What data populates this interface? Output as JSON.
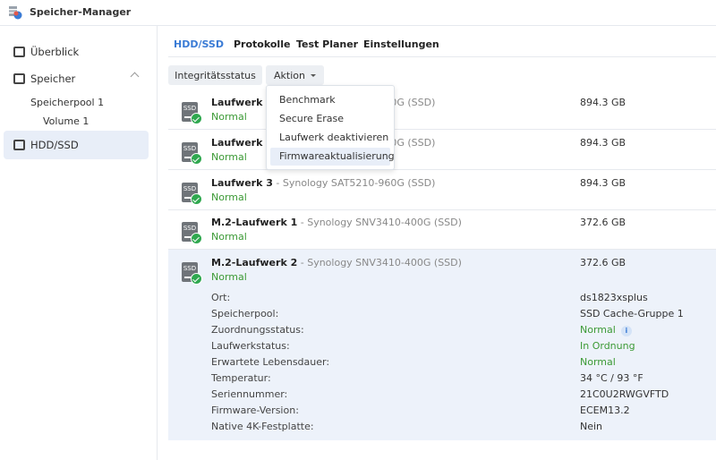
{
  "app": {
    "title": "Speicher-Manager"
  },
  "sidebar": {
    "items": [
      {
        "label": "Überblick",
        "icon": "overview-icon"
      },
      {
        "label": "Speicher",
        "icon": "storage-icon"
      },
      {
        "label": "Speicherpool 1"
      },
      {
        "label": "Volume 1"
      },
      {
        "label": "HDD/SSD",
        "icon": "drive-icon",
        "active": true
      }
    ]
  },
  "tabs": [
    {
      "label": "HDD/SSD",
      "active": true
    },
    {
      "label": "Protokolle"
    },
    {
      "label": "Test Planer"
    },
    {
      "label": "Einstellungen"
    }
  ],
  "toolbar": {
    "health_label": "Integritätsstatus",
    "action_label": "Aktion"
  },
  "menu": {
    "items": [
      "Benchmark",
      "Secure Erase",
      "Laufwerk deaktivieren",
      "Firmwareaktualisierung"
    ],
    "highlighted": "Firmwareaktualisierung"
  },
  "drives": [
    {
      "name": "Laufwerk 1",
      "model": " - Synology SAT5210-960G (SSD)",
      "status": "Normal",
      "size": "894.3 GB"
    },
    {
      "name": "Laufwerk 2",
      "model": " - Synology SAT5210-960G (SSD)",
      "status": "Normal",
      "size": "894.3 GB"
    },
    {
      "name": "Laufwerk 3",
      "model": " - Synology SAT5210-960G (SSD)",
      "status": "Normal",
      "size": "894.3 GB"
    },
    {
      "name": "M.2-Laufwerk 1",
      "model": " - Synology SNV3410-400G (SSD)",
      "status": "Normal",
      "size": "372.6 GB"
    },
    {
      "name": "M.2-Laufwerk 2",
      "model": " - Synology SNV3410-400G (SSD)",
      "status": "Normal",
      "size": "372.6 GB"
    }
  ],
  "details": [
    {
      "label": "Ort:",
      "value": "ds1823xsplus"
    },
    {
      "label": "Speicherpool:",
      "value": "SSD Cache-Gruppe 1"
    },
    {
      "label": "Zuordnungsstatus:",
      "value": "Normal",
      "green": true,
      "info": "i"
    },
    {
      "label": "Laufwerkstatus:",
      "value": "In Ordnung",
      "green": true
    },
    {
      "label": "Erwartete Lebensdauer:",
      "value": "Normal",
      "green": true
    },
    {
      "label": "Temperatur:",
      "value": "34 °C / 93 °F"
    },
    {
      "label": "Seriennummer:",
      "value": "21C0U2RWGVFTD"
    },
    {
      "label": "Firmware-Version:",
      "value": "ECEM13.2"
    },
    {
      "label": "Native 4K-Festplatte:",
      "value": "Nein"
    }
  ],
  "colors": {
    "accent": "#3a7bd5",
    "ok": "#3c9a36",
    "selected": "#edf2fa"
  }
}
